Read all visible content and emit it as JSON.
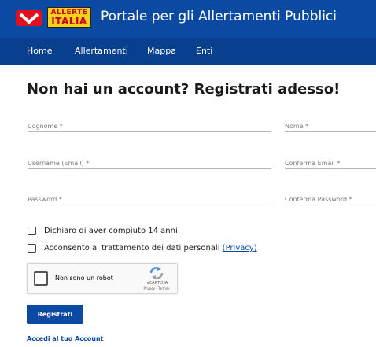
{
  "header": {
    "logo": {
      "line1": "ALLERTE",
      "line2": "ITALIA"
    },
    "title": "Portale per gli Allertamenti Pubblici",
    "nav": [
      "Home",
      "Allertamenti",
      "Mappa",
      "Enti"
    ]
  },
  "form": {
    "heading": "Non hai un account? Registrati adesso!",
    "fields": {
      "cognome": "Cognome *",
      "nome": "Nome *",
      "username": "Username (Email) *",
      "conferma_email": "Conferma Email *",
      "password": "Password *",
      "conferma_password": "Conferma Password *"
    },
    "checks": {
      "age": "Dichiaro di aver compiuto 14 anni",
      "privacy_text": "Acconsento al trattamento dei dati personali",
      "privacy_link": "(Privacy)"
    },
    "captcha": {
      "label": "Non sono un robot",
      "brand": "reCAPTCHA",
      "terms": "Privacy - Termini"
    },
    "submit": "Registrati",
    "login_link": "Accedi al tuo Account"
  },
  "colors": {
    "header_blue": "#0b4aa2",
    "nav_blue": "#08408f",
    "logo_yellow": "#f7d117",
    "logo_red": "#c4001a"
  }
}
